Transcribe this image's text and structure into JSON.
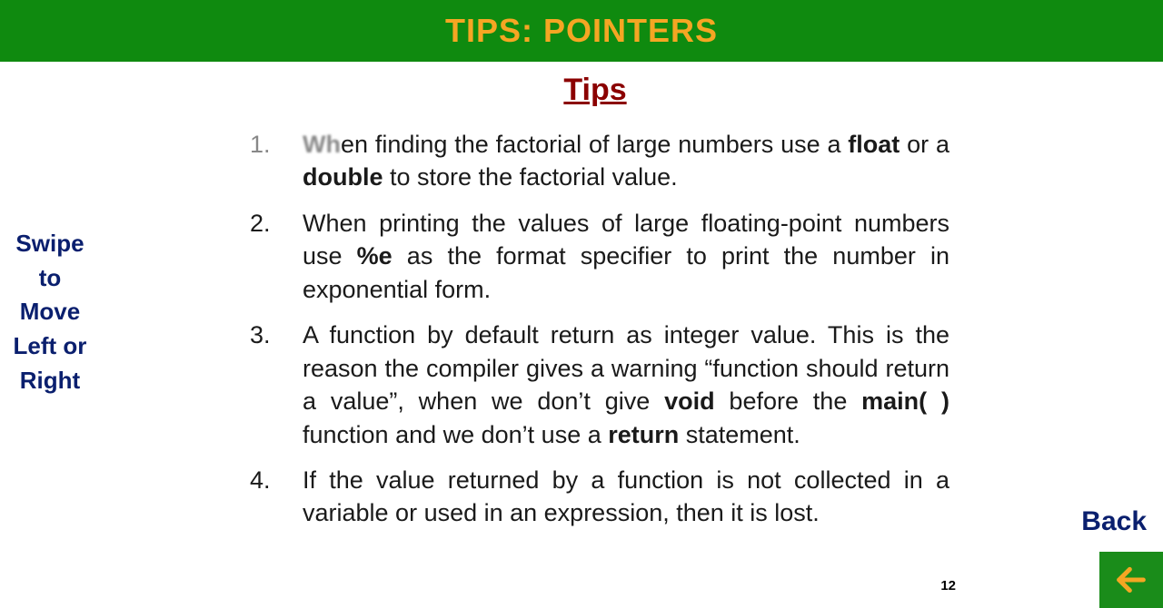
{
  "header": {
    "title": "TIPS: POINTERS"
  },
  "swipe_hint": "Swipe to Move Left or Right",
  "content": {
    "heading": "Tips",
    "tips": [
      {
        "prefix": "Wh",
        "t1": "en finding the factorial of large numbers use a ",
        "b1": "float",
        "t2": " or a ",
        "b2": "double",
        "t3": " to store the factorial value."
      },
      {
        "t1": "When printing the values of large floating-point numbers use ",
        "b1": "%e",
        "t2": " as the format specifier to print the number in exponential form."
      },
      {
        "t1": "A function by default return as integer value. This is the reason the compiler gives a warning “function should return a value”, when we don’t give ",
        "b1": "void",
        "t2": " before the ",
        "b2": "main( )",
        "t3": " function and we don’t use a ",
        "b3": "return",
        "t4": " statement."
      },
      {
        "t1": "If the value returned by a function is not collected in a variable or used in an expression, then it is lost."
      }
    ]
  },
  "back": {
    "label": "Back"
  },
  "page_number": "12"
}
